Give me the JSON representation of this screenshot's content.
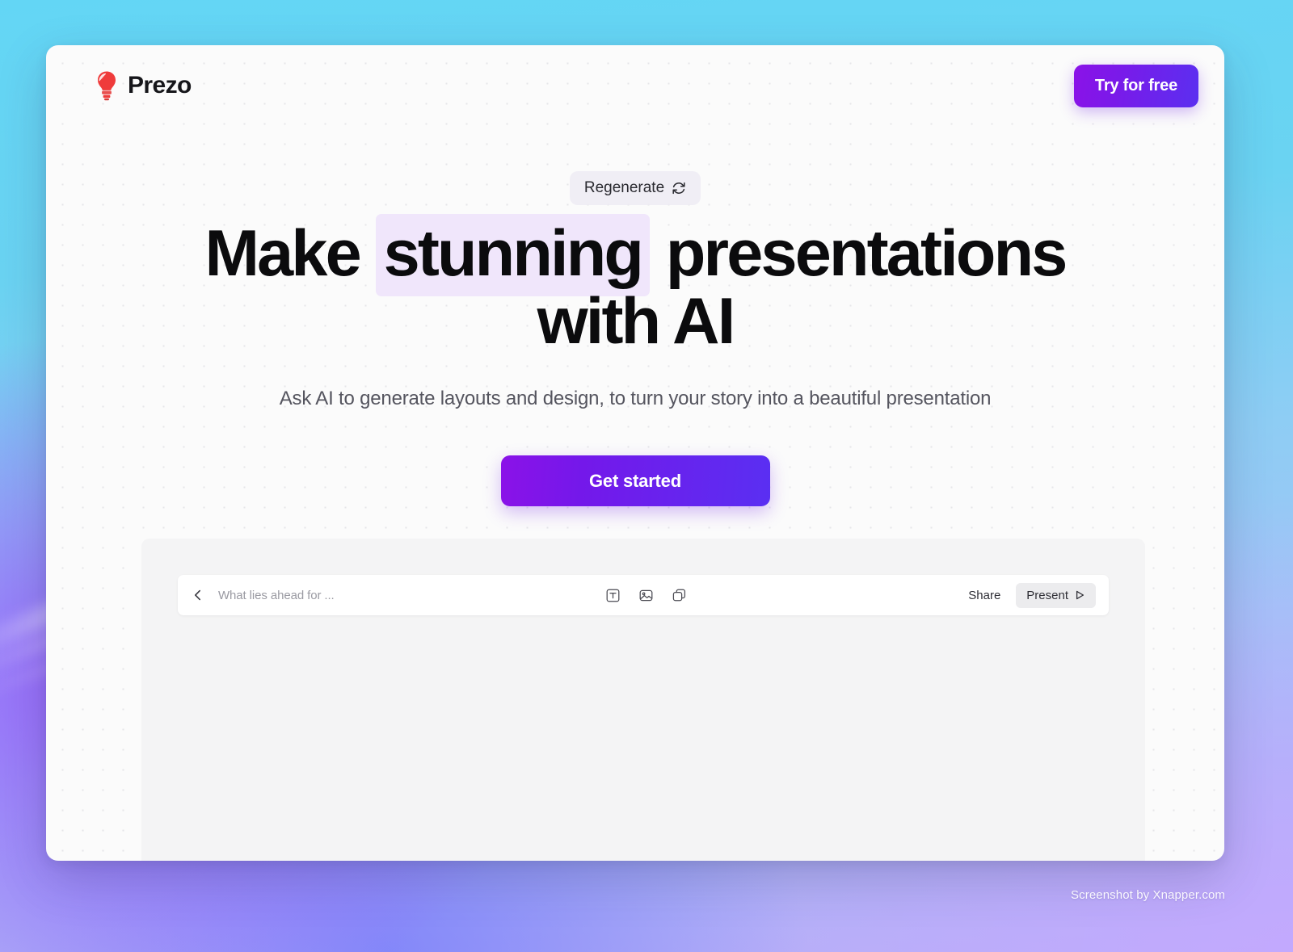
{
  "brand": {
    "name": "Prezo",
    "logo_icon": "lightbulb-icon",
    "logo_color": "#ef3b3b"
  },
  "header": {
    "cta_label": "Try for free"
  },
  "hero": {
    "regenerate_label": "Regenerate",
    "regenerate_icon": "refresh-cycle-icon",
    "headline_part1": "Make ",
    "headline_highlight": "stunning",
    "headline_part2": " presentations with AI",
    "highlight_color": "#f0e6fb",
    "subheadline": "Ask AI to generate layouts and design, to turn your story into a beautiful presentation",
    "cta_label": "Get started",
    "cta_gradient_from": "#8b12e8",
    "cta_gradient_to": "#5a2ff2"
  },
  "editor": {
    "back_icon": "chevron-left-icon",
    "document_title": "What lies ahead for ...",
    "tools": [
      {
        "name": "text-tool-icon",
        "label": "Text"
      },
      {
        "name": "image-tool-icon",
        "label": "Image"
      },
      {
        "name": "shape-tool-icon",
        "label": "Shape"
      }
    ],
    "share_label": "Share",
    "present_label": "Present",
    "present_icon": "play-icon"
  },
  "watermark": {
    "text": "Screenshot by Xnapper.com"
  }
}
